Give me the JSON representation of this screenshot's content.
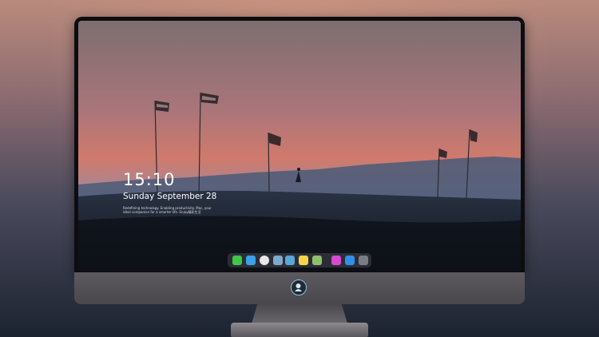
{
  "lock_screen": {
    "time": "15:10",
    "date": "Sunday September 28",
    "blurb": "Redefining technology. Enabling productivity. Mac, your ideal companion for a smarter life. Enjoy精彩生活"
  },
  "dock": {
    "items": [
      {
        "icon": "messages-icon",
        "color": "#3ec74a"
      },
      {
        "icon": "finder-icon",
        "color": "#3aa0e8"
      },
      {
        "icon": "safari-icon",
        "color": "#e8e8ea"
      },
      {
        "icon": "preview-icon",
        "color": "#7fa9c9"
      },
      {
        "icon": "final-cut-icon",
        "color": "#5aa6d8"
      },
      {
        "icon": "notes-icon",
        "color": "#f5d44a"
      },
      {
        "icon": "photos-icon",
        "color": "#8fc06a"
      },
      {
        "icon": "itunes-icon",
        "color": "#d64ad0"
      },
      {
        "icon": "app-store-icon",
        "color": "#2f8fe8"
      },
      {
        "icon": "camera-icon",
        "color": "#7a7d86"
      }
    ]
  },
  "colors": {
    "sky_top": "#8a7474",
    "sky_mid": "#c97a72",
    "hills": "#4a5b78",
    "ground": "#161d28"
  }
}
